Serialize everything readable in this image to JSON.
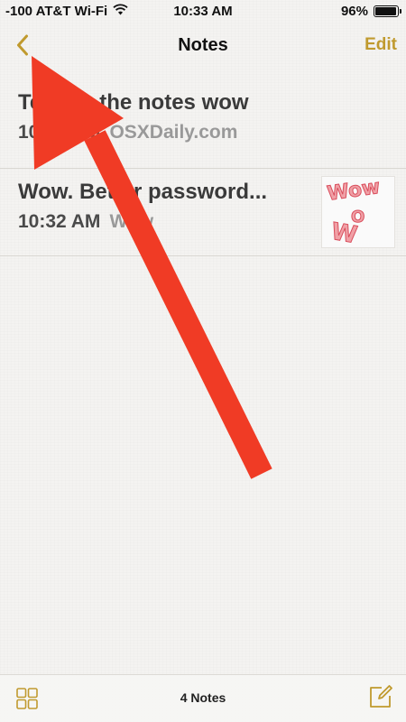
{
  "status_bar": {
    "carrier": "-100 AT&T Wi-Fi",
    "time": "10:33 AM",
    "battery": "96%",
    "battery_level": 0.96,
    "wifi_icon": "wifi-icon"
  },
  "nav": {
    "back_icon": "chevron-left-icon",
    "title": "Notes",
    "edit_label": "Edit"
  },
  "notes": [
    {
      "title": "Testing the notes wow",
      "time": "10:33 AM",
      "preview": "OSXDaily.com",
      "thumbnail": false
    },
    {
      "title": "Wow. Better password...",
      "time": "10:32 AM",
      "preview": "Wow",
      "thumbnail": true
    }
  ],
  "thumbnail_text": [
    "Wow",
    "O",
    "W"
  ],
  "toolbar": {
    "grid_icon": "grid-icon",
    "count": "4 Notes",
    "compose_icon": "compose-icon"
  },
  "colors": {
    "accent": "#c09a2e",
    "arrow": "#f03b25",
    "background": "#f4f3f1"
  }
}
